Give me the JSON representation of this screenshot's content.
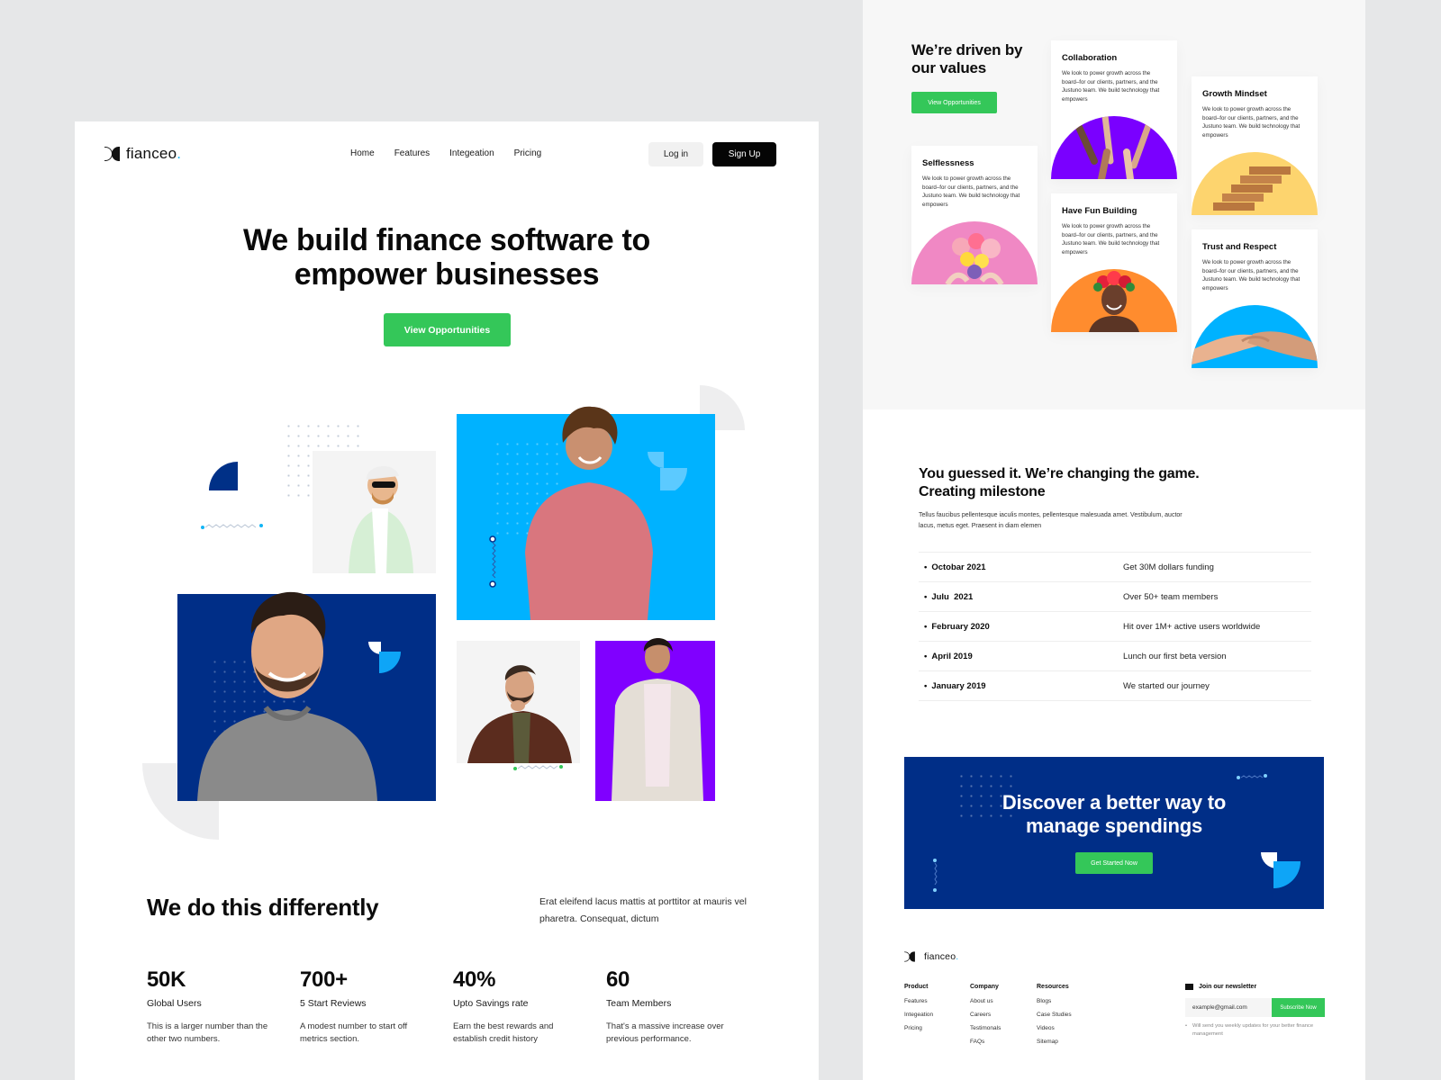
{
  "brand": {
    "name": "fianceo",
    "dot": ".",
    "accent": "#12b5f5",
    "green": "#34c759",
    "navy": "#002e87",
    "sky": "#00b2ff",
    "purple": "#8000ff"
  },
  "nav": {
    "links": [
      "Home",
      "Features",
      "Integeation",
      "Pricing"
    ],
    "login": "Log in",
    "signup": "Sign Up"
  },
  "hero": {
    "title_line1": "We build finance software to",
    "title_line2": "empower businesses",
    "cta": "View Opportunities",
    "photos": [
      "person-sunglasses-cap",
      "person-curly-hair-pink-tee",
      "person-beard-gray-sweater",
      "person-thinking-brown-blazer",
      "person-white-jacket"
    ]
  },
  "stats": {
    "title": "We do this differently",
    "intro": "Erat eleifend lacus mattis at porttitor at mauris vel pharetra. Consequat, dictum",
    "items": [
      {
        "value": "50K",
        "label": "Global Users",
        "desc": "This is a larger number than the other two numbers."
      },
      {
        "value": "700+",
        "label": "5 Start Reviews",
        "desc": "A modest number to start off metrics section."
      },
      {
        "value": "40%",
        "label": "Upto Savings rate",
        "desc": "Earn the best rewards and establish credit history"
      },
      {
        "value": "60",
        "label": "Team Members",
        "desc": "That's a massive increase over previous performance."
      }
    ]
  },
  "values": {
    "title_line1": "We’re driven by",
    "title_line2": "our values",
    "cta": "View Opportunities",
    "cards": [
      {
        "title": "Selflessness",
        "desc": "We look to power growth across the board–for our clients, partners, and the Justuno team. We build technology that empowers",
        "color": "#f088c4",
        "image": "flowers-heart"
      },
      {
        "title": "Collaboration",
        "desc": "We look to power growth across the board–for our clients, partners, and the Justuno team. We build technology that empowers",
        "color": "#7a00ff",
        "image": "hands-together"
      },
      {
        "title": "Have Fun Building",
        "desc": "We look to power growth across the board–for our clients, partners, and the Justuno team. We build technology that empowers",
        "color": "#ff8c2e",
        "image": "woman-flower-crown"
      },
      {
        "title": "Growth Mindset",
        "desc": "We look to power growth across the board–for our clients, partners, and the Justuno team. We build technology that empowers",
        "color": "#fdd46e",
        "image": "wooden-stairs"
      },
      {
        "title": "Trust and Respect",
        "desc": "We look to power growth across the board–for our clients, partners, and the Justuno team. We build technology that empowers",
        "color": "#00b2ff",
        "image": "handshake"
      }
    ]
  },
  "milestones": {
    "title": "You guessed it. We’re changing the game. Creating milestone",
    "desc": "Tellus faucibus pellentesque iaculis montes, pellentesque malesuada amet. Vestibulum, auctor lacus, metus eget. Praesent in diam elemen",
    "rows": [
      {
        "date": "Octobar 2021",
        "event": "Get 30M dollars funding"
      },
      {
        "date": "Julu  2021",
        "event": "Over 50+ team members"
      },
      {
        "date": "February 2020",
        "event": "Hit over 1M+ active users worldwide"
      },
      {
        "date": "April 2019",
        "event": "Lunch our first beta version"
      },
      {
        "date": "January 2019",
        "event": "We started our journey"
      }
    ]
  },
  "cta_banner": {
    "title_line1": "Discover a better way to",
    "title_line2": "manage spendings",
    "button": "Get Started Now"
  },
  "footer": {
    "columns": [
      {
        "title": "Product",
        "links": [
          "Features",
          "Integeation",
          "Pricing"
        ]
      },
      {
        "title": "Company",
        "links": [
          "About us",
          "Careers",
          "Testimonals",
          "FAQs"
        ]
      },
      {
        "title": "Resources",
        "links": [
          "Blogs",
          "Case Studies",
          "Videos",
          "Sitemap"
        ]
      }
    ],
    "newsletter": {
      "title": "Join our newsletter",
      "email_value": "example@gmail.com",
      "button": "Subscribe Now",
      "note": "Will send you weekly updates for your better finance management"
    }
  }
}
